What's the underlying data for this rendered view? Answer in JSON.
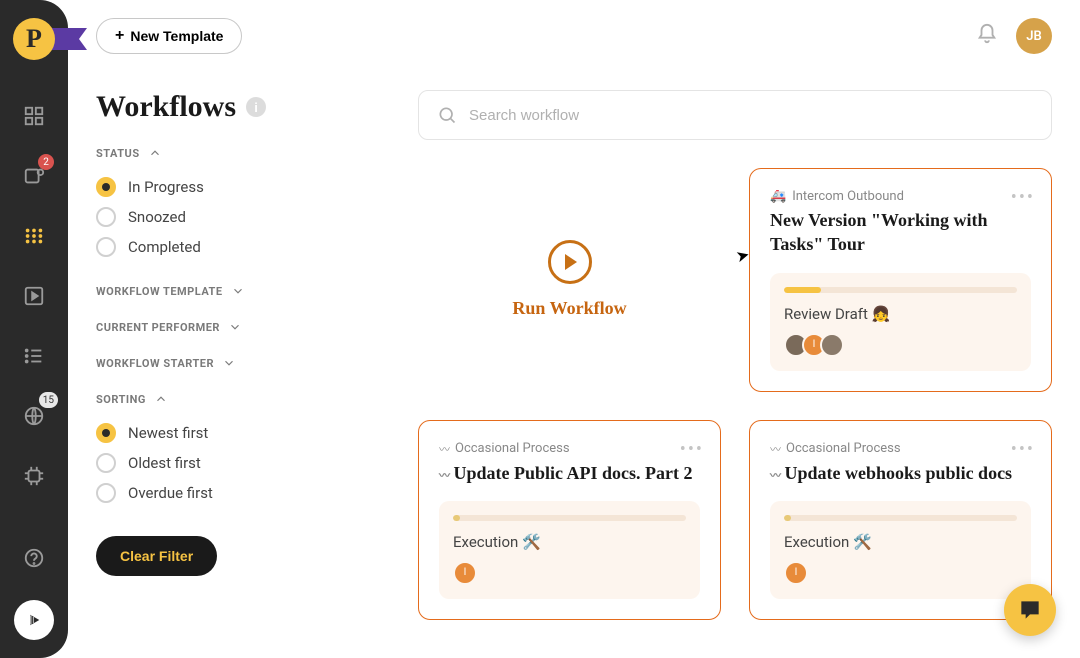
{
  "header": {
    "new_template_btn": "New Template",
    "user_initials": "JB"
  },
  "nav": {
    "badge_tasks": "2",
    "badge_count": "15"
  },
  "page": {
    "title": "Workflows"
  },
  "filters": {
    "status_header": "STATUS",
    "status_options": [
      "In Progress",
      "Snoozed",
      "Completed"
    ],
    "status_selected": 0,
    "template_header": "WORKFLOW TEMPLATE",
    "performer_header": "CURRENT PERFORMER",
    "starter_header": "WORKFLOW STARTER",
    "sorting_header": "SORTING",
    "sorting_options": [
      "Newest first",
      "Oldest first",
      "Overdue first"
    ],
    "sorting_selected": 0,
    "clear_btn": "Clear Filter"
  },
  "search": {
    "placeholder": "Search workflow"
  },
  "cards": {
    "run_label": "Run Workflow",
    "items": [
      {
        "template": "Intercom Outbound",
        "template_prefix": "🚑",
        "title": "New Version \"Working with Tasks\" Tour",
        "task": "Review Draft 👧",
        "progress_pct": 16,
        "progress_style": "fill",
        "avatars": 3
      },
      {
        "template": "Occasional Process",
        "template_prefix_wave": true,
        "title_prefix_wave": true,
        "title": "Update Public API docs. Part 2",
        "task": "Execution 🛠️",
        "progress_pct": 3,
        "progress_style": "dot",
        "avatars": 1
      },
      {
        "template": "Occasional Process",
        "template_prefix_wave": true,
        "title_prefix_wave": true,
        "title": "Update webhooks public docs",
        "task": "Execution 🛠️",
        "progress_pct": 3,
        "progress_style": "dot",
        "avatars": 1
      }
    ]
  }
}
